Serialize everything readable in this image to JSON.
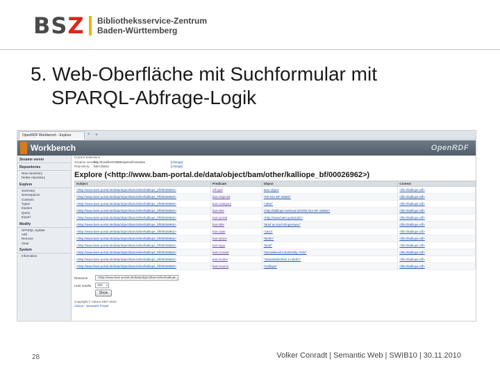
{
  "logo": {
    "mark_b": "BS",
    "mark_z": "Z",
    "line1": "Bibliotheksservice-Zentrum",
    "line2": "Baden-Württemberg",
    "colors": {
      "mark": "#4a4a4a",
      "z": "#e2231a",
      "bar": "#f2b400"
    }
  },
  "slide": {
    "title_line1": "5. Web-Oberfläche mit Suchformular mit",
    "title_line2": "SPARQL-Abfrage-Logik",
    "page_number": "28",
    "footer": "Volker Conradt | Semantic Web | SWIB10 | 30.11.2010"
  },
  "browser": {
    "tab_label": "OpenRDF Workbench - Explore",
    "tab_close": "×",
    "new_tab": "+"
  },
  "workbench": {
    "title": "Workbench",
    "brand": "OpenRDF",
    "colors": {
      "banner": "#5e6975",
      "mark": "#d77b1f",
      "sidebar": "#e9ecf0"
    },
    "sidebar": [
      {
        "heading": "Sesame server",
        "items": []
      },
      {
        "heading": "Repositories",
        "items": [
          "New repository",
          "Delete repository"
        ]
      },
      {
        "heading": "Explore",
        "items": [
          "Summary",
          "Namespaces",
          "Contexts",
          "Types",
          "Explore",
          "Query",
          "Export"
        ]
      },
      {
        "heading": "Modify",
        "items": [
          "SPARQL Update",
          "Add",
          "Remove",
          "Clear"
        ]
      },
      {
        "heading": "System",
        "items": [
          "Information"
        ]
      }
    ],
    "info": [
      {
        "key": "Current Selections",
        "value": "",
        "link": ""
      },
      {
        "key": "Sesame server:",
        "value": "http://localhost:8080/openrdf-sesame",
        "link": "[change]"
      },
      {
        "key": "Repository:",
        "value": "bam (bam)",
        "link": "[change]"
      }
    ],
    "explore_title": "Explore (<http://www.bam-portal.de/data/object/bam/other/kalliope_bf/00026962>)",
    "table": {
      "headers": [
        "Subject",
        "Predicate",
        "Object",
        "Context"
      ],
      "rows": [
        [
          "<http://www.bam-portal.de/data/object/bam/other/kalliope_bf/00026962>",
          "rdf:type",
          "bam:object",
          "<file://kalliope.rdf>"
        ],
        [
          "<http://www.bam-portal.de/data/object/bam/other/kalliope_bf/00026962>",
          "bam:objectid",
          "\"DE-611-BF-26962\"",
          "<file://kalliope.rdf>"
        ],
        [
          "<http://www.bam-portal.de/data/object/bam/other/kalliope_bf/00026962>",
          "bam:category",
          "\"other\"",
          "<file://kalliope.rdf>"
        ],
        [
          "<http://www.bam-portal.de/data/object/bam/other/kalliope_bf/00026962>",
          "bam:link",
          "<http://kalliope-verbund.info/DE-611-BF-26962>",
          "<file://kalliope.rdf>"
        ],
        [
          "<http://www.bam-portal.de/data/object/bam/other/kalliope_bf/00026962>",
          "bam:portal",
          "<http://www.bam-portal.de/>",
          "<file://kalliope.rdf>"
        ],
        [
          "<http://www.bam-portal.de/data/object/bam/other/kalliope_bf/00026962>",
          "bam:title",
          "\"Brief an Karl Klingemann\"",
          "<file://kalliope.rdf>"
        ],
        [
          "<http://www.bam-portal.de/data/object/bam/other/kalliope_bf/00026962>",
          "bam:date",
          "\"1844\"",
          "<file://kalliope.rdf>"
        ],
        [
          "<http://www.bam-portal.de/data/object/bam/other/kalliope_bf/00026962>",
          "bam:place",
          "\"Berlin\"",
          "<file://kalliope.rdf>"
        ],
        [
          "<http://www.bam-portal.de/data/object/bam/other/kalliope_bf/00026962>",
          "bam:type",
          "\"Brief\"",
          "<file://kalliope.rdf>"
        ],
        [
          "<http://www.bam-portal.de/data/object/bam/other/kalliope_bf/00026962>",
          "bam:creator",
          "\"Mendelssohn Bartholdy, Felix\"",
          "<file://kalliope.rdf>"
        ],
        [
          "<http://www.bam-portal.de/data/object/bam/other/kalliope_bf/00026962>",
          "bam:holder",
          "\"Staatsbibliothek zu Berlin\"",
          "<file://kalliope.rdf>"
        ],
        [
          "<http://www.bam-portal.de/data/object/bam/other/kalliope_bf/00026962>",
          "bam:source",
          "\"Kalliope\"",
          "<file://kalliope.rdf>"
        ]
      ]
    },
    "form": {
      "resource_label": "Resource",
      "resource_value": "<http://www.bam-portal.de/data/object/bam/other/kalliope_bf/00026962>",
      "limit_label": "Limit results",
      "limit_value": "100",
      "show_button": "Show"
    },
    "footer_copy": "Copyright © Aduna 1997-2010",
    "footer_links": "Aduna - Semantic Power"
  }
}
